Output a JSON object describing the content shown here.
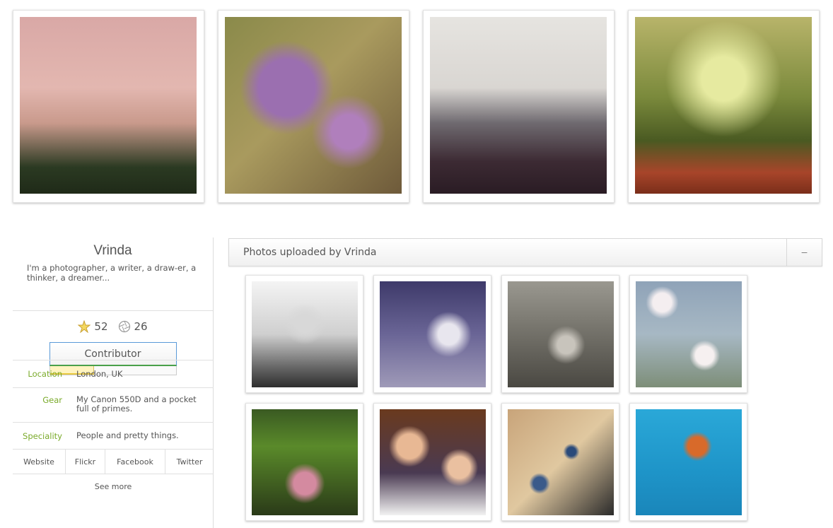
{
  "featured": [
    {
      "name": "pink-sky-trees",
      "style": "p-pink"
    },
    {
      "name": "purple-flower",
      "style": "p-flower"
    },
    {
      "name": "cattails-fog",
      "style": "p-cattail"
    },
    {
      "name": "autumn-forest-walker",
      "style": "p-forest"
    }
  ],
  "profile": {
    "name": "Vrinda",
    "bio": "I'm a photographer, a writer, a draw-er, a thinker, a dreamer...",
    "stars": "52",
    "apertures": "26",
    "rank_label": "Contributor",
    "rank_progress": 0.35,
    "location_label": "Location",
    "location_value": "London, UK",
    "gear_label": "Gear",
    "gear_value": "My Canon 550D and a pocket full of primes.",
    "speciality_label": "Speciality",
    "speciality_value": "People and pretty things.",
    "links": [
      "Website",
      "Flickr",
      "Facebook",
      "Twitter"
    ],
    "see_more": "See more"
  },
  "uploads": {
    "title": "Photos uploaded by Vrinda",
    "toggle_label": "–",
    "photos": [
      {
        "name": "jumping-man",
        "style": "p-jump"
      },
      {
        "name": "angelfish",
        "style": "p-fish"
      },
      {
        "name": "hermit-crab",
        "style": "p-shell"
      },
      {
        "name": "cherry-blossom",
        "style": "p-blossom"
      },
      {
        "name": "lotus-bud",
        "style": "p-lotus"
      },
      {
        "name": "wedding-couple",
        "style": "p-wedding"
      },
      {
        "name": "pebbles",
        "style": "p-stones"
      },
      {
        "name": "robin-bird",
        "style": "p-robin"
      }
    ]
  },
  "colors": {
    "accent_green": "#7aaa2a",
    "button_blue": "#5a9ad8"
  }
}
